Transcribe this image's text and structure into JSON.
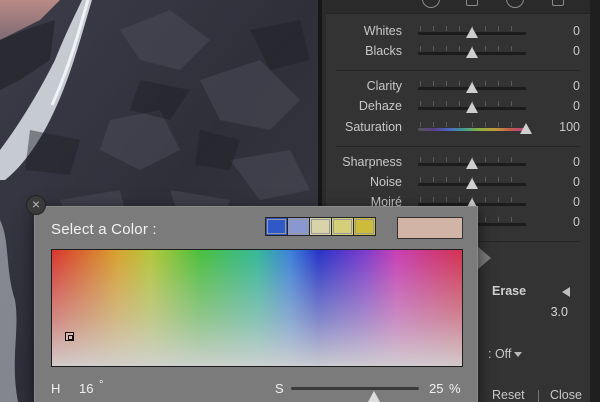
{
  "adjustments": {
    "rows": [
      {
        "label": "Whites",
        "value": "0",
        "pos": 0.5
      },
      {
        "label": "Blacks",
        "value": "0",
        "pos": 0.5
      },
      {
        "label": "Clarity",
        "value": "0",
        "pos": 0.5
      },
      {
        "label": "Dehaze",
        "value": "0",
        "pos": 0.5
      },
      {
        "label": "Saturation",
        "value": "100",
        "pos": 1.0
      },
      {
        "label": "Sharpness",
        "value": "0",
        "pos": 0.5
      },
      {
        "label": "Noise",
        "value": "0",
        "pos": 0.5
      },
      {
        "label": "Moiré",
        "value": "0",
        "pos": 0.5
      },
      {
        "label": "",
        "value": "0",
        "pos": 0.5
      }
    ]
  },
  "brush": {
    "erase_label": "Erase",
    "size_value": "3.0",
    "auto_mask": ": Off",
    "reset_label": "Reset",
    "close_label": "Close"
  },
  "color_picker": {
    "title": "Select a Color :",
    "close_glyph": "×",
    "swatches": [
      "#2f58c8",
      "#8a98d2",
      "#d8d3a8",
      "#d5cf7a",
      "#cdbb3a"
    ],
    "selected_color": "#d2b4a6",
    "hue_label": "H",
    "hue_value": "16",
    "hue_unit": "°",
    "sat_label": "S",
    "sat_value": "25",
    "sat_unit": "%",
    "sat_fraction": 0.25
  },
  "colors": {
    "panel_bg": "#333333",
    "popup_bg": "#7b7b7b"
  }
}
